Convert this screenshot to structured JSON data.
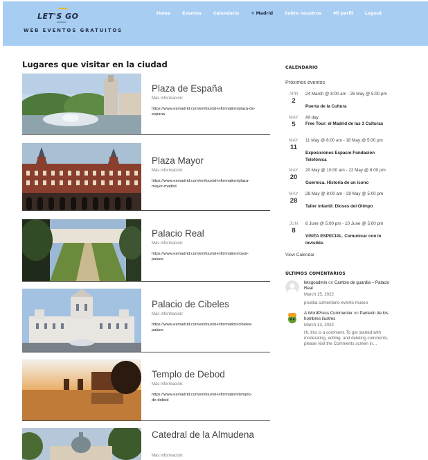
{
  "header": {
    "logo_text": "LET'S GO",
    "logo_sub": "MADRID",
    "tagline": "WEB EVENTOS GRATUITOS",
    "nav": [
      "Home",
      "Eventos",
      "Calendario",
      "+ Madrid",
      "Sobre nosotros",
      "Mi perfil",
      "Logout"
    ]
  },
  "main": {
    "title": "Lugares que visitar en la ciudad",
    "places": [
      {
        "name": "Plaza de España",
        "more": "Más información:",
        "link": "https://www.esmadrid.com/en/tourist-information/plaza-de-espana"
      },
      {
        "name": "Plaza Mayor",
        "more": "Más información:",
        "link": "https://www.esmadrid.com/en/tourist-information/plaza-mayor-madrid"
      },
      {
        "name": "Palacio Real",
        "more": "Más información:",
        "link": "https://www.esmadrid.com/en/tourist-information/royal-palace"
      },
      {
        "name": "Palacio de Cibeles",
        "more": "Más información:",
        "link": "https://www.esmadrid.com/en/tourist-information/cibeles-palace"
      },
      {
        "name": "Templo de Debod",
        "more": "Más información:",
        "link": "https://www.esmadrid.com/en/tourist-information/templo-de-debod"
      },
      {
        "name": "Catedral de la Almudena",
        "more": "Más información:",
        "link": ""
      }
    ]
  },
  "sidebar": {
    "calendar_heading": "CALENDARIO",
    "upcoming_label": "Próximos eventos",
    "events": [
      {
        "month": "APR",
        "day": "2",
        "when": "24 March @ 8:00 am - 26 May @ 5:00 pm",
        "title": "Puerta de la Cultura"
      },
      {
        "month": "MAY",
        "day": "5",
        "when": "All day",
        "title": "Free Tour: el Madrid de las 3 Culturas"
      },
      {
        "month": "MAY",
        "day": "11",
        "when": "11 May @ 8:00 am - 18 May @ 5:00 pm",
        "title": "Exposiciones Espacio Fundación Telefónica"
      },
      {
        "month": "MAY",
        "day": "20",
        "when": "20 May @ 10:00 am - 22 May @ 8:00 pm",
        "title": "Guernica. Historia de un icono"
      },
      {
        "month": "MAY",
        "day": "28",
        "when": "28 May @ 8:00 am - 29 May @ 5:00 pm",
        "title": "Taller infantil: Dioses del Olimpo"
      },
      {
        "month": "JUN",
        "day": "8",
        "when": "8 June @ 5:00 pm - 10 June @ 5:00 pm",
        "title": "VISITA ESPECIAL. Comunicar con lo invisible."
      }
    ],
    "view_calendar": "View Calendar",
    "comments_heading": "ÚLTIMOS COMENTARIOS",
    "comments": [
      {
        "author": "letsgoadmin",
        "on": "on",
        "post": "Cambio de guardia – Palacio Real",
        "date": "March 15, 2022",
        "excerpt": "prueba comentario evento museo"
      },
      {
        "author": "A WordPress Commenter",
        "on": "on",
        "post": "Panteón de los hombres ilustres",
        "date": "March 13, 2022",
        "excerpt": "Hi, this is a comment. To get started with moderating, editing, and deleting comments, please visit the Comments screen in…"
      }
    ]
  }
}
